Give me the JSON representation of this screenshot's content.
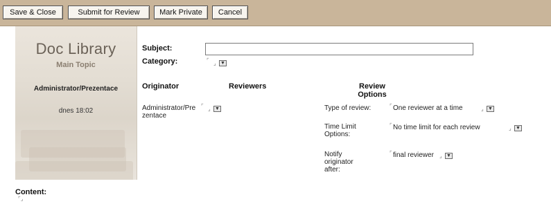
{
  "toolbar": {
    "save_close": "Save & Close",
    "submit_review": "Submit for Review",
    "mark_private": "Mark Private",
    "cancel": "Cancel"
  },
  "sidebar": {
    "title": "Doc Library",
    "subtitle": "Main Topic",
    "author": "Administrator/Prezentace",
    "date": "dnes 18:02"
  },
  "form": {
    "subject_label": "Subject:",
    "subject_value": "",
    "category_label": "Category:",
    "originator_header": "Originator",
    "reviewers_header": "Reviewers",
    "review_options_header": "Review Options",
    "originator_name": "Administrator/Prezentace",
    "type_of_review_label": "Type of review:",
    "type_of_review_value": "One reviewer at a time",
    "time_limit_label": "Time Limit Options:",
    "time_limit_value": "No time limit for each review",
    "notify_label": "Notify originator after:",
    "notify_value": "final reviewer",
    "content_label": "Content:"
  },
  "icons": {
    "dropdown": "dropdown-arrow-icon",
    "field_corner": "field-corner-icon"
  },
  "colors": {
    "toolbar_bg": "#c9b59a",
    "panel_bg": "#e3ddd3"
  }
}
